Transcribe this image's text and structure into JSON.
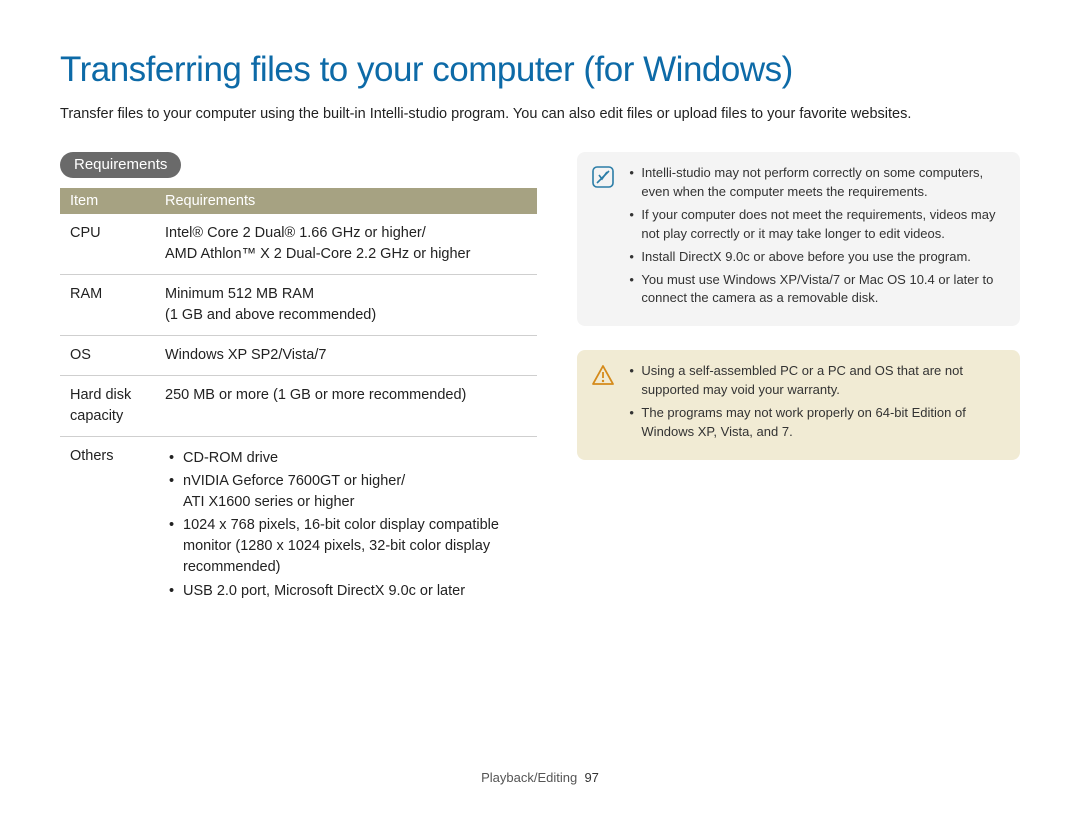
{
  "title": "Transferring files to your computer (for Windows)",
  "intro": "Transfer files to your computer using the built-in Intelli-studio program. You can also edit files or upload files to your favorite websites.",
  "section_heading": "Requirements",
  "table": {
    "headers": {
      "item": "Item",
      "req": "Requirements"
    },
    "rows": {
      "cpu": {
        "label": "CPU",
        "value": "Intel® Core 2 Dual® 1.66 GHz or higher/\nAMD Athlon™ X 2 Dual-Core 2.2 GHz or higher"
      },
      "ram": {
        "label": "RAM",
        "value": "Minimum 512 MB RAM\n(1 GB and above recommended)"
      },
      "os": {
        "label": "OS",
        "value": "Windows XP SP2/Vista/7"
      },
      "hdd": {
        "label": "Hard disk capacity",
        "value": "250 MB or more (1 GB or more recommended)"
      },
      "others": {
        "label": "Others",
        "items": [
          "CD-ROM drive",
          "nVIDIA Geforce 7600GT or higher/\nATI X1600 series or higher",
          "1024 x 768 pixels, 16-bit color display compatible monitor (1280 x 1024 pixels, 32-bit color display recommended)",
          "USB 2.0 port, Microsoft DirectX 9.0c or later"
        ]
      }
    }
  },
  "info_notes": [
    "Intelli-studio may not perform correctly on some computers, even when the computer meets the requirements.",
    "If your computer does not meet the requirements, videos may not play correctly or it may take longer to edit videos.",
    "Install DirectX 9.0c or above before you use the program.",
    "You must use Windows XP/Vista/7 or Mac OS 10.4 or later to connect the camera as a removable disk."
  ],
  "warn_notes": [
    "Using a self-assembled PC or a PC and OS that are not supported may void your warranty.",
    "The programs may not work properly on 64-bit Edition of Windows XP, Vista, and 7."
  ],
  "footer": {
    "section": "Playback/Editing",
    "page": "97"
  }
}
